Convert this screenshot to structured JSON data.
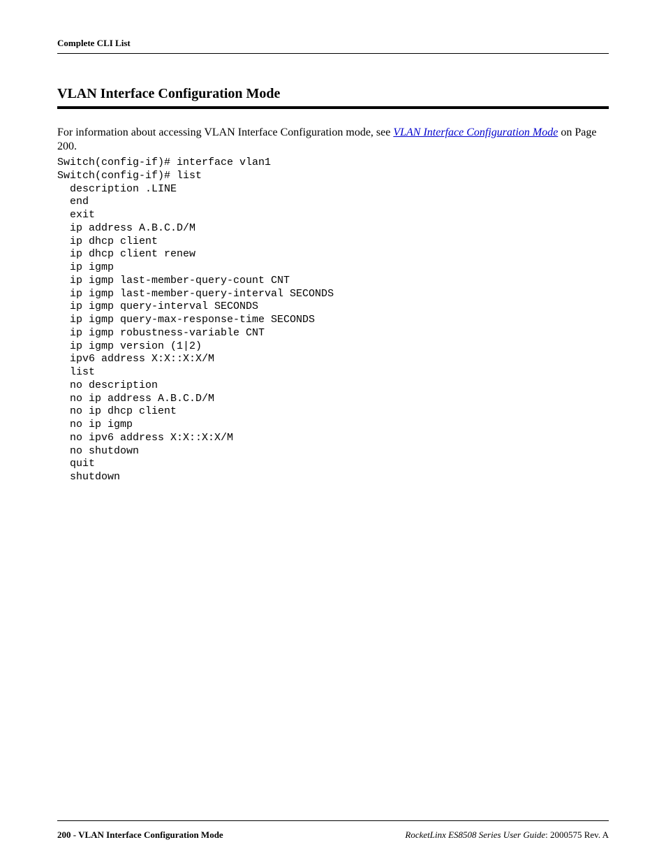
{
  "header": {
    "label": "Complete CLI List"
  },
  "section": {
    "title": "VLAN Interface Configuration Mode"
  },
  "intro": {
    "prefix": "For information about accessing VLAN Interface Configuration mode, see ",
    "link_text": "VLAN Interface Configuration Mode",
    "suffix": " on Page 200."
  },
  "cli": {
    "lines": [
      "Switch(config-if)# interface vlan1",
      "Switch(config-if)# list",
      "  description .LINE",
      "  end",
      "  exit",
      "  ip address A.B.C.D/M",
      "  ip dhcp client",
      "  ip dhcp client renew",
      "  ip igmp",
      "  ip igmp last-member-query-count CNT",
      "  ip igmp last-member-query-interval SECONDS",
      "  ip igmp query-interval SECONDS",
      "  ip igmp query-max-response-time SECONDS",
      "  ip igmp robustness-variable CNT",
      "  ip igmp version (1|2)",
      "  ipv6 address X:X::X:X/M",
      "  list",
      "  no description",
      "  no ip address A.B.C.D/M",
      "  no ip dhcp client",
      "  no ip igmp",
      "  no ipv6 address X:X::X:X/M",
      "  no shutdown",
      "  quit",
      "  shutdown"
    ]
  },
  "footer": {
    "left": "200 - VLAN Interface Configuration Mode",
    "right_italic": "RocketLinx ES8508 Series  User Guide",
    "right_plain": ": 2000575 Rev. A"
  }
}
